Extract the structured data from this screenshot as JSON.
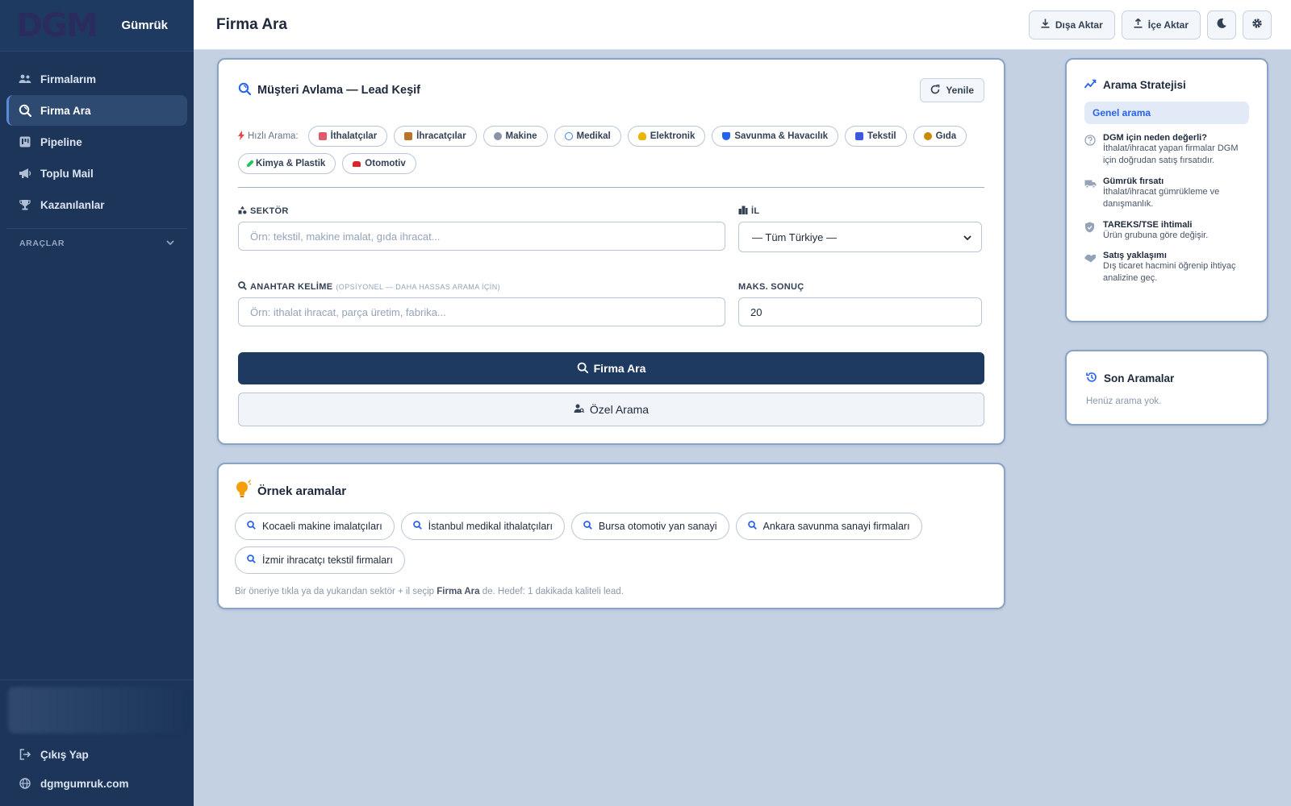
{
  "brand": {
    "logo": "DGM",
    "name": "Gümrük"
  },
  "sidebar": {
    "items": [
      {
        "label": "Firmalarım",
        "icon": "users-icon"
      },
      {
        "label": "Firma Ara",
        "icon": "search-radar-icon",
        "active": true
      },
      {
        "label": "Pipeline",
        "icon": "kanban-icon"
      },
      {
        "label": "Toplu Mail",
        "icon": "megaphone-icon"
      },
      {
        "label": "Kazanılanlar",
        "icon": "trophy-icon"
      }
    ],
    "section_label": "ARAÇLAR",
    "bottom": [
      {
        "label": "Çıkış Yap",
        "icon": "logout-icon"
      },
      {
        "label": "dgmgumruk.com",
        "icon": "globe-icon"
      }
    ]
  },
  "header": {
    "title": "Firma Ara",
    "export_label": "Dışa Aktar",
    "import_label": "İçe Aktar"
  },
  "search_card": {
    "title": "Müşteri Avlama — Lead Keşif",
    "refresh_label": "Yenile",
    "quick_label": "Hızlı Arama:",
    "quick_chips": [
      {
        "label": "İthalatçılar",
        "color": "#e05a6a"
      },
      {
        "label": "İhracatçılar",
        "color": "#b7742a"
      },
      {
        "label": "Makine",
        "color": "#8a94a6"
      },
      {
        "label": "Medikal",
        "color": "#3b82f6"
      },
      {
        "label": "Elektronik",
        "color": "#eab308"
      },
      {
        "label": "Savunma & Havacılık",
        "color": "#2563eb"
      },
      {
        "label": "Tekstil",
        "color": "#3b5bdb"
      },
      {
        "label": "Gıda",
        "color": "#ca8a04"
      },
      {
        "label": "Kimya & Plastik",
        "color": "#22c55e"
      },
      {
        "label": "Otomotiv",
        "color": "#dc2626"
      }
    ],
    "sector_label": "SEKTÖR",
    "sector_placeholder": "Örn: tekstil, makine imalat, gıda ihracat...",
    "city_label": "İL",
    "city_value": "— Tüm Türkiye —",
    "keyword_label": "ANAHTAR KELİME",
    "keyword_sub": "(OPSİYONEL — DAHA HASSAS ARAMA İÇİN)",
    "keyword_placeholder": "Örn: ithalat ihracat, parça üretim, fabrika...",
    "max_label": "MAKS. SONUÇ",
    "max_value": "20",
    "search_button": "Firma Ara",
    "custom_button": "Özel Arama"
  },
  "examples": {
    "title": "Örnek aramalar",
    "items": [
      "Kocaeli makine imalatçıları",
      "İstanbul medikal ithalatçıları",
      "Bursa otomotiv yan sanayi",
      "Ankara savunma sanayi firmaları",
      "İzmir ihracatçı tekstil firmaları"
    ],
    "hint_pre": "Bir öneriye tıkla ya da yukarıdan sektör + il seçip",
    "hint_bold": "Firma Ara",
    "hint_post": "de. Hedef: 1 dakikada kaliteli lead."
  },
  "strategy": {
    "title": "Arama Stratejisi",
    "pill": "Genel arama",
    "tips": [
      {
        "icon": "question-icon",
        "title": "DGM için neden değerli?",
        "body": "İthalat/ihracat yapan firmalar DGM için doğrudan satış fırsatıdır."
      },
      {
        "icon": "truck-icon",
        "title": "Gümrük fırsatı",
        "body": "İthalat/ihracat gümrükleme ve danışmanlık."
      },
      {
        "icon": "shield-icon",
        "title": "TAREKS/TSE ihtimali",
        "body": "Ürün grubuna göre değişir."
      },
      {
        "icon": "handshake-icon",
        "title": "Satış yaklaşımı",
        "body": "Dış ticaret hacmini öğrenip ihtiyaç analizine geç."
      }
    ]
  },
  "recent": {
    "title": "Son Aramalar",
    "empty": "Henüz arama yok."
  }
}
